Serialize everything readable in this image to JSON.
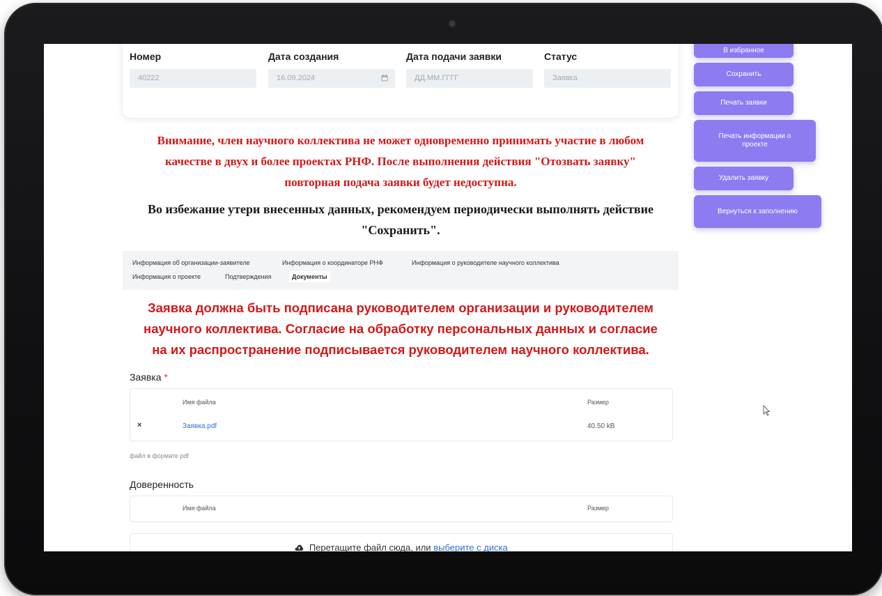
{
  "form": {
    "number_label": "Номер",
    "number_value": "40222",
    "created_label": "Дата создания",
    "created_value": "16.09.2024",
    "submitted_label": "Дата подачи заявки",
    "submitted_placeholder": "ДД.ММ.ГГГГ",
    "status_label": "Статус",
    "status_value": "Заявка"
  },
  "warnings": {
    "red_line1": "Внимание, член научного коллектива не может одновременно принимать участие в любом",
    "red_line2": "качестве в двух и более проектах РНФ. После выполнения действия \"Отозвать заявку\"",
    "red_line3": "повторная подача заявки будет недоступна.",
    "black_line1": "Во избежание утери внесенных данных, рекомендуем периодически выполнять действие",
    "black_line2": "\"Сохранить\"."
  },
  "tabs": [
    {
      "label": "Информация об организации-заявителе"
    },
    {
      "label": "Информация о координаторе РНФ"
    },
    {
      "label": "Информация о руководителе научного коллектива"
    },
    {
      "label": "Информация о проекте"
    },
    {
      "label": "Подтверждения"
    },
    {
      "label": "Документы"
    }
  ],
  "notice": {
    "line1": "Заявка должна быть подписана руководителем организации и руководителем",
    "line2": "научного коллектива. Согласие на обработку персональных данных и согласие",
    "line3": "на их распространение подписывается руководителем научного коллектива."
  },
  "application": {
    "title": "Заявка",
    "required_mark": "*",
    "col_name": "Имя файла",
    "col_size": "Размер",
    "file_name": "Заявка.pdf",
    "file_size": "40.50 kB",
    "remove_symbol": "×",
    "hint": "файл в формате pdf"
  },
  "power_of_attorney": {
    "title": "Доверенность",
    "col_name": "Имя файла",
    "col_size": "Размер"
  },
  "dropzone": {
    "text": "Перетащите файл сюда, или",
    "link": "выберите с диска"
  },
  "sidebar": {
    "partial_top": "В избранное",
    "save": "Сохранить",
    "print_app": "Печать заявки",
    "print_info": "Печать информации о проекте",
    "delete": "Удалить заявку",
    "back": "Вернуться к заполнению"
  },
  "colors": {
    "accent": "#8c7bf1",
    "warning_red": "#d41818",
    "link": "#2f6fd3"
  }
}
